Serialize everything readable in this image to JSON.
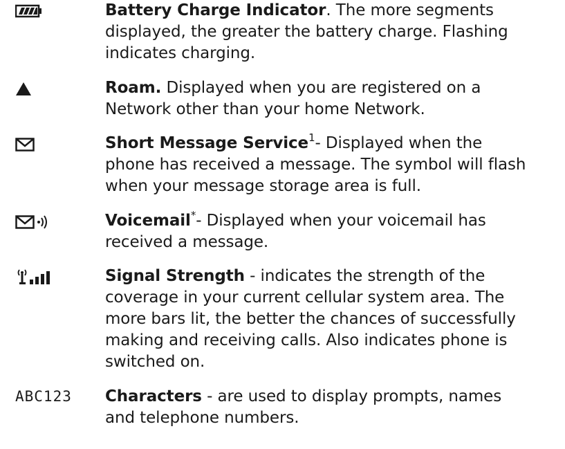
{
  "entries": [
    {
      "icon": "battery-icon",
      "term": "Battery Charge Indicator",
      "after_term": ". The more segments",
      "lines": [
        "displayed, the greater the battery charge. Flashing",
        "indicates charging."
      ]
    },
    {
      "icon": "roam-triangle-icon",
      "term": "Roam.",
      "after_term": " Displayed when you are registered on a",
      "lines": [
        "Network other than your home Network."
      ]
    },
    {
      "icon": "envelope-icon",
      "term": "Short Message Service",
      "sup": "1",
      "after_term": "- Displayed when the",
      "lines": [
        "phone has received a message. The symbol will flash",
        "when your message storage area is full."
      ]
    },
    {
      "icon": "voicemail-icon",
      "term": "Voicemail",
      "sup": "*",
      "after_term": "- Displayed when your voicemail has",
      "lines": [
        "received a message."
      ]
    },
    {
      "icon": "signal-strength-icon",
      "term": "Signal Strength",
      "after_term": " - indicates the strength of the",
      "lines": [
        "coverage in your current cellular system area. The",
        "more bars lit, the better the chances of successfully",
        "making and receiving calls. Also indicates phone is",
        "switched on."
      ]
    },
    {
      "icon": "characters-icon",
      "icon_text": "ABC123",
      "term": "Characters",
      "after_term": " - are used to display prompts, names",
      "lines": [
        "and telephone numbers."
      ]
    }
  ]
}
